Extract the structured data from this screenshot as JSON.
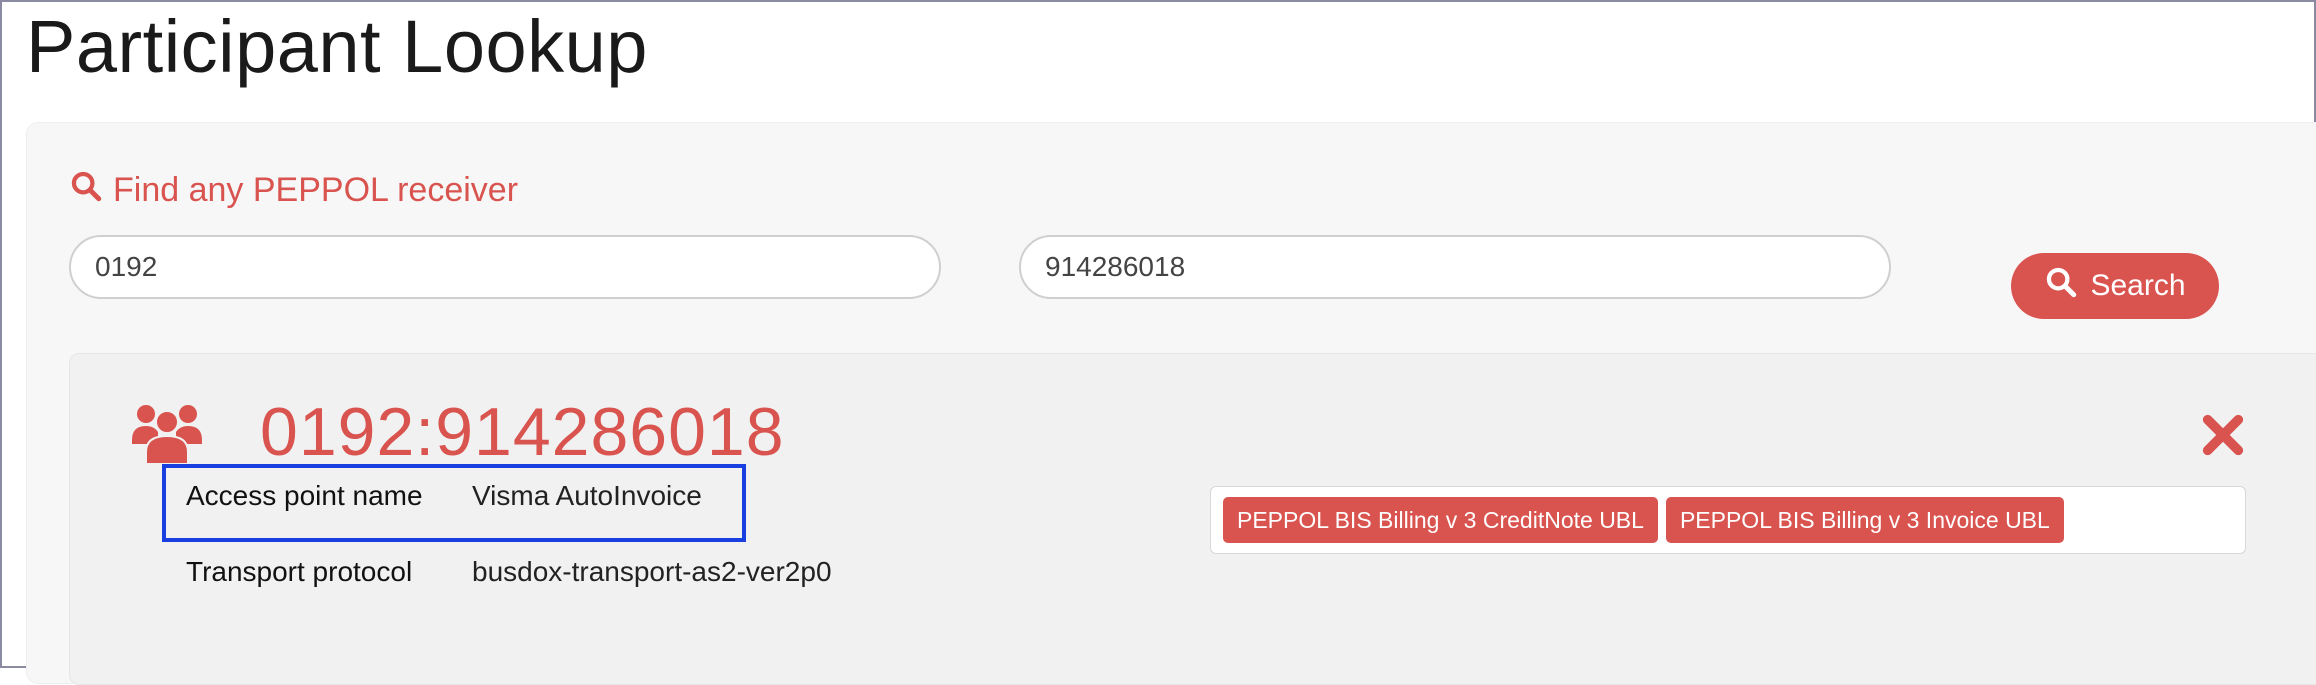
{
  "page": {
    "title": "Participant Lookup"
  },
  "search": {
    "heading": "Find any PEPPOL receiver",
    "scheme_value": "0192",
    "identifier_value": "914286018",
    "button_label": "Search"
  },
  "result": {
    "participant_scheme": "0192",
    "separator": ":",
    "participant_id": "914286018",
    "access_point_label": "Access point name",
    "access_point_value": "Visma AutoInvoice",
    "transport_label": "Transport protocol",
    "transport_value": "busdox-transport-as2-ver2p0",
    "document_types": [
      "PEPPOL BIS Billing v 3 CreditNote UBL",
      "PEPPOL BIS Billing v 3 Invoice UBL"
    ]
  },
  "colors": {
    "accent": "#d9534f",
    "highlight": "#1a3fe0"
  },
  "icons": [
    "search-icon",
    "users-icon",
    "close-icon"
  ]
}
